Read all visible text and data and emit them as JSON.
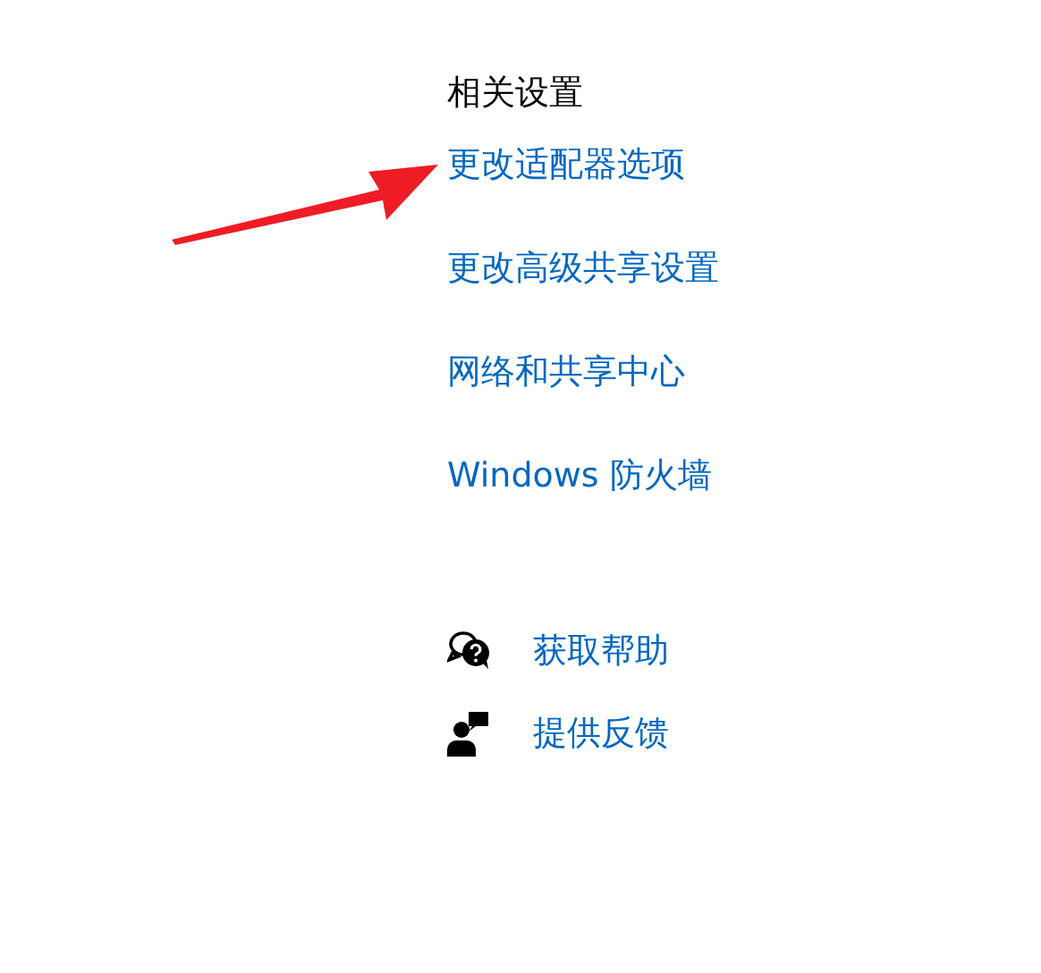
{
  "related_settings": {
    "title": "相关设置",
    "links": [
      "更改适配器选项",
      "更改高级共享设置",
      "网络和共享中心",
      "Windows 防火墙"
    ]
  },
  "support": [
    {
      "kind": "help",
      "label": "获取帮助"
    },
    {
      "kind": "feedback",
      "label": "提供反馈"
    }
  ]
}
